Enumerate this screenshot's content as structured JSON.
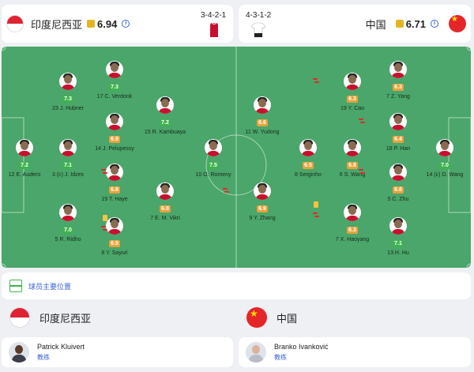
{
  "header": {
    "home": {
      "name": "印度尼西亚",
      "rating": "6.94",
      "formation": "3-4-2-1"
    },
    "away": {
      "name": "中国",
      "rating": "6.71",
      "formation": "4-3-1-2"
    }
  },
  "home_players": [
    {
      "number": "23",
      "name": "J. Hubner",
      "rating": "7.3",
      "color": "green"
    },
    {
      "number": "17",
      "name": "C. Verdonk",
      "rating": "7.3",
      "color": "green"
    },
    {
      "number": "15",
      "name": "R. Kambuaya",
      "rating": "7.2",
      "color": "green"
    },
    {
      "number": "14",
      "name": "J. Pelupessy",
      "rating": "6.9",
      "color": "orange"
    },
    {
      "number": "12",
      "name": "E. Audero",
      "rating": "7.2",
      "color": "green"
    },
    {
      "number": "3",
      "name": "(c) J. Idzes",
      "rating": "7.1",
      "color": "green"
    },
    {
      "number": "10",
      "name": "O. Romeny",
      "rating": "7.5",
      "color": "green"
    },
    {
      "number": "19",
      "name": "T. Haye",
      "rating": "6.8",
      "color": "orange"
    },
    {
      "number": "7",
      "name": "E. M. Vikri",
      "rating": "6.8",
      "color": "orange"
    },
    {
      "number": "5",
      "name": "R. Ridho",
      "rating": "7.0",
      "color": "green"
    },
    {
      "number": "8",
      "name": "Y. Sayuri",
      "rating": "6.9",
      "color": "orange"
    }
  ],
  "away_players": [
    {
      "number": "7",
      "name": "Z. Yang",
      "rating": "6.3",
      "color": "orange"
    },
    {
      "number": "19",
      "name": "Y. Cao",
      "rating": "6.3",
      "color": "orange"
    },
    {
      "number": "11",
      "name": "W. Yudong",
      "rating": "6.6",
      "color": "orange"
    },
    {
      "number": "18",
      "name": "P. Han",
      "rating": "6.4",
      "color": "orange"
    },
    {
      "number": "8",
      "name": "Serginho",
      "rating": "6.5",
      "color": "orange"
    },
    {
      "number": "6",
      "name": "S. Wang",
      "rating": "6.8",
      "color": "orange"
    },
    {
      "number": "14",
      "name": "(c) D. Wang",
      "rating": "7.0",
      "color": "green"
    },
    {
      "number": "5",
      "name": "C. Zhu",
      "rating": "6.8",
      "color": "orange"
    },
    {
      "number": "9",
      "name": "Y. Zhang",
      "rating": "6.9",
      "color": "orange"
    },
    {
      "number": "7",
      "name": "X. Haoyang",
      "rating": "6.3",
      "color": "orange"
    },
    {
      "number": "13",
      "name": "H. Hu",
      "rating": "7.1",
      "color": "green"
    }
  ],
  "positions_link": "球员主要位置",
  "teams": {
    "home": "印度尼西亚",
    "away": "中国"
  },
  "coaches": {
    "home": {
      "name": "Patrick Kluivert",
      "role": "教练"
    },
    "away": {
      "name": "Branko Ivanković",
      "role": "教练"
    }
  },
  "colors": {
    "pitch": "#4aa66a",
    "green_rating": "#3fb34f",
    "orange_rating": "#e8a23a",
    "link": "#3b63d6"
  }
}
